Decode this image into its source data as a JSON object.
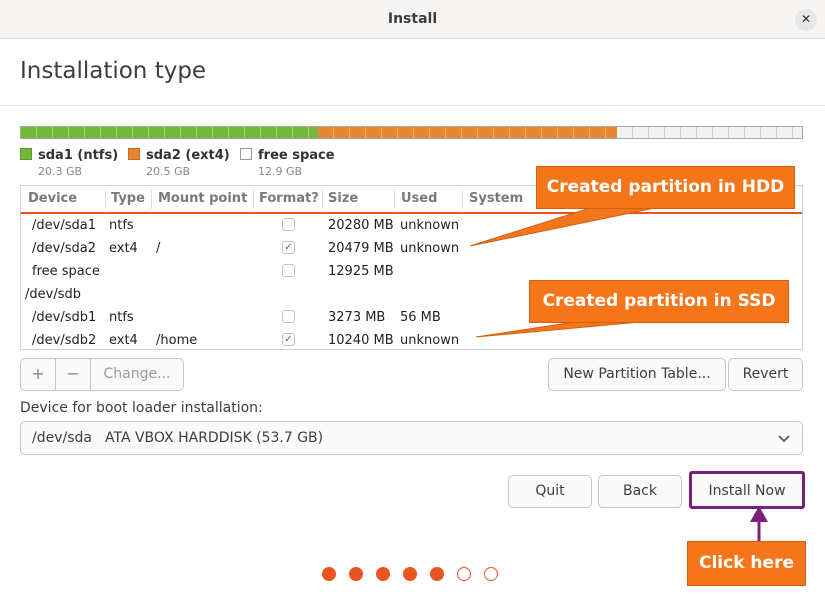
{
  "window": {
    "title": "Install",
    "close_glyph": "✕"
  },
  "page": {
    "title": "Installation type"
  },
  "partition_bar": {
    "segments": [
      {
        "name": "sda1 (ntfs)",
        "size": "20.3 GB",
        "color": "#73b83a"
      },
      {
        "name": "sda2 (ext4)",
        "size": "20.5 GB",
        "color": "#e68532"
      },
      {
        "name": "free space",
        "size": "12.9 GB",
        "color": "#f2f2f2"
      }
    ]
  },
  "table": {
    "columns": [
      "Device",
      "Type",
      "Mount point",
      "Format?",
      "Size",
      "Used",
      "System"
    ],
    "rows": [
      {
        "device": "/dev/sda1",
        "type": "ntfs",
        "mount": "",
        "format": false,
        "size": "20280 MB",
        "used": "unknown"
      },
      {
        "device": "/dev/sda2",
        "type": "ext4",
        "mount": "/",
        "format": true,
        "size": "20479 MB",
        "used": "unknown"
      },
      {
        "device": "free space",
        "type": "",
        "mount": "",
        "format": false,
        "size": "12925 MB",
        "used": ""
      },
      {
        "device": "/dev/sdb",
        "type": "",
        "mount": "",
        "format": null,
        "size": "",
        "used": ""
      },
      {
        "device": "/dev/sdb1",
        "type": "ntfs",
        "mount": "",
        "format": false,
        "size": "3273 MB",
        "used": "56 MB"
      },
      {
        "device": "/dev/sdb2",
        "type": "ext4",
        "mount": "/home",
        "format": true,
        "size": "10240 MB",
        "used": "unknown"
      }
    ]
  },
  "partition_controls": {
    "add": "+",
    "remove": "−",
    "change": "Change..."
  },
  "new_partition_table": "New Partition Table...",
  "revert": "Revert",
  "boot_loader": {
    "label": "Device for boot loader installation:",
    "device": "/dev/sda",
    "description": "ATA VBOX HARDDISK (53.7 GB)"
  },
  "actions": {
    "quit": "Quit",
    "back": "Back",
    "install_now": "Install Now"
  },
  "annotations": {
    "hdd": "Created partition in HDD",
    "ssd": "Created partition in SSD",
    "click": "Click here",
    "callout_color": "#f5761a",
    "highlight_color": "#7a1f7a"
  },
  "progress": {
    "total_steps": 7,
    "completed_steps": 5,
    "accent": "#e95420"
  }
}
